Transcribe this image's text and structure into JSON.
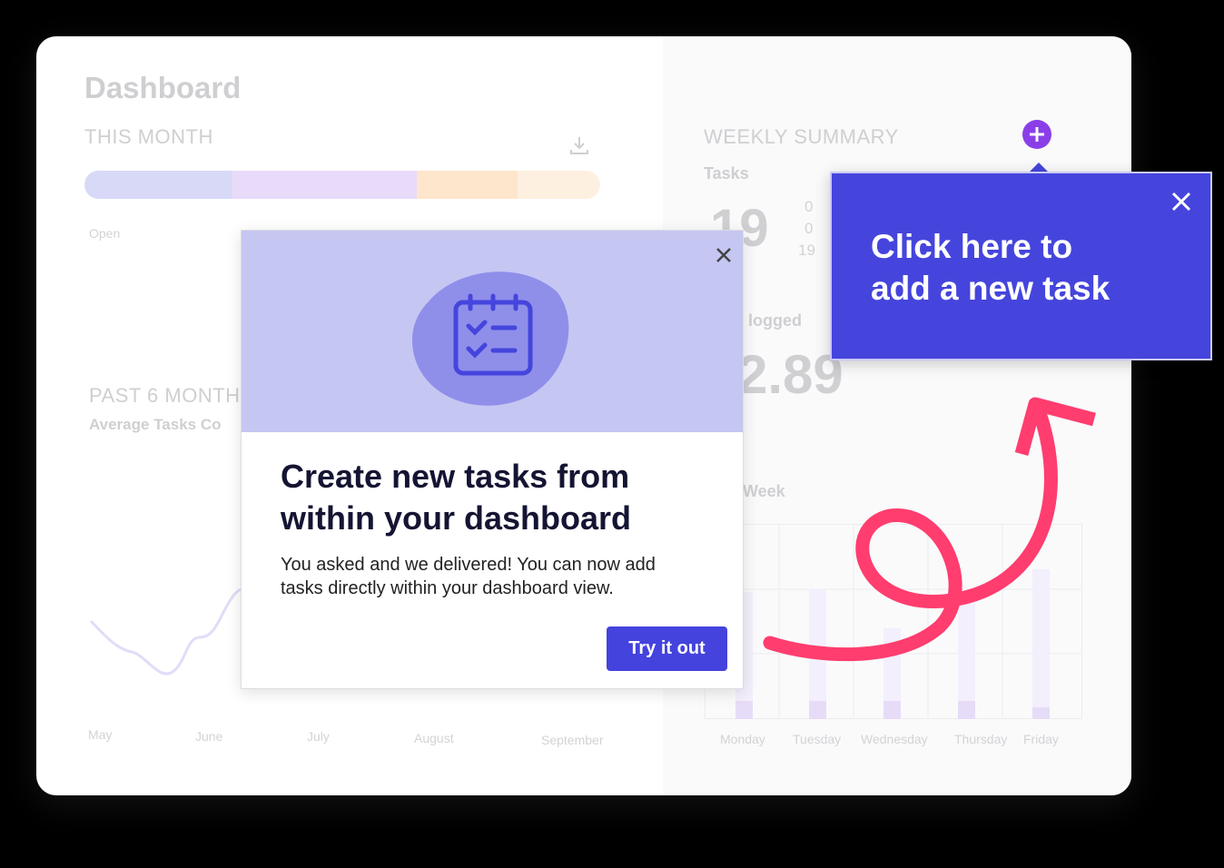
{
  "dashboard": {
    "title": "Dashboard",
    "this_month": {
      "label": "THIS MONTH",
      "status_labels": [
        "Open"
      ],
      "segments": [
        {
          "color": "#d8d9f6",
          "fraction": 0.285
        },
        {
          "color": "#e8daf9",
          "fraction": 0.36
        },
        {
          "color": "#fee6cc",
          "fraction": 0.195
        },
        {
          "color": "#fef0e0",
          "fraction": 0.16
        }
      ]
    },
    "past_six_months": {
      "label": "PAST 6 MONTH",
      "sublabel": "Average Tasks Co",
      "months": [
        "May",
        "June",
        "July",
        "August",
        "September"
      ]
    },
    "weekly_summary": {
      "label": "WEEKLY SUMMARY",
      "tasks_label": "Tasks",
      "tasks_total": "19",
      "task_breakdown": [
        "0",
        "0",
        "19"
      ],
      "logged_label": "logged",
      "logged_value": "2.89",
      "week_label": "Week",
      "days": [
        "Monday",
        "Tuesday",
        "Wednesday",
        "Thursday",
        "Friday"
      ]
    }
  },
  "modal": {
    "heading_line1": "Create new tasks from",
    "heading_line2": "within your dashboard",
    "body_line1": "You asked and we delivered! You can now add",
    "body_line2": "tasks directly within your dashboard view.",
    "cta": "Try it out",
    "icon": "calendar-checklist-icon"
  },
  "tooltip": {
    "line1": "Click here to",
    "line2": "add a new task"
  },
  "colors": {
    "accent": "#4443dd",
    "annotation": "#ff3d6e",
    "add_button": "#8a3ee8"
  }
}
